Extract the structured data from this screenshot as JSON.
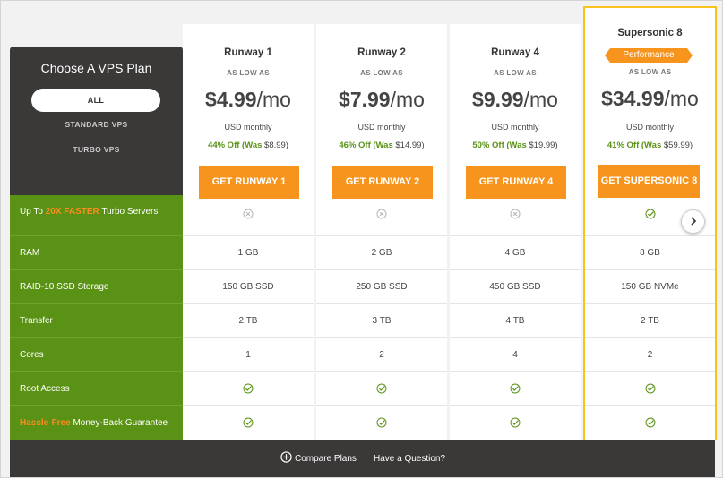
{
  "sidebar": {
    "title": "Choose A VPS Plan",
    "filters": [
      "ALL",
      "STANDARD VPS",
      "TURBO VPS"
    ],
    "features": [
      {
        "pre": "Up To ",
        "hl": "20X FASTER",
        "post": " Turbo Servers"
      },
      {
        "pre": "RAM",
        "hl": "",
        "post": ""
      },
      {
        "pre": "RAID-10 SSD Storage",
        "hl": "",
        "post": ""
      },
      {
        "pre": "Transfer",
        "hl": "",
        "post": ""
      },
      {
        "pre": "Cores",
        "hl": "",
        "post": ""
      },
      {
        "pre": "Root Access",
        "hl": "",
        "post": ""
      },
      {
        "pre": "",
        "hl": "Hassle-Free",
        "post": " Money-Back Guarantee"
      }
    ]
  },
  "plans": [
    {
      "name": "Runway 1",
      "badge": "",
      "low": "AS LOW AS",
      "price": "$4.99",
      "period": "/mo",
      "usd": "USD monthly",
      "off": "44% Off (Was",
      "was": " $8.99)",
      "cta": "GET RUNWAY 1",
      "turbo": "x",
      "ram": "1 GB",
      "storage": "150 GB SSD",
      "transfer": "2 TB",
      "cores": "1",
      "root": "check",
      "guarantee": "check"
    },
    {
      "name": "Runway 2",
      "badge": "",
      "low": "AS LOW AS",
      "price": "$7.99",
      "period": "/mo",
      "usd": "USD monthly",
      "off": "46% Off (Was",
      "was": " $14.99)",
      "cta": "GET RUNWAY 2",
      "turbo": "x",
      "ram": "2 GB",
      "storage": "250 GB SSD",
      "transfer": "3 TB",
      "cores": "2",
      "root": "check",
      "guarantee": "check"
    },
    {
      "name": "Runway 4",
      "badge": "",
      "low": "AS LOW AS",
      "price": "$9.99",
      "period": "/mo",
      "usd": "USD monthly",
      "off": "50% Off (Was",
      "was": " $19.99)",
      "cta": "GET RUNWAY 4",
      "turbo": "x",
      "ram": "4 GB",
      "storage": "450 GB SSD",
      "transfer": "4 TB",
      "cores": "4",
      "root": "check",
      "guarantee": "check"
    },
    {
      "name": "Supersonic 8",
      "badge": "Performance",
      "low": "AS LOW AS",
      "price": "$34.99",
      "period": "/mo",
      "usd": "USD monthly",
      "off": "41% Off (Was",
      "was": " $59.99)",
      "cta": "GET SUPERSONIC 8",
      "turbo": "check",
      "ram": "8 GB",
      "storage": "150 GB NVMe",
      "transfer": "2 TB",
      "cores": "2",
      "root": "check",
      "guarantee": "check"
    }
  ],
  "footer": {
    "compare": "Compare Plans",
    "question": "Have a Question?"
  },
  "colors": {
    "accent": "#f7941d",
    "green": "#5a9216",
    "dark": "#3b3838",
    "featured_border": "#f9c21f"
  },
  "icons": {
    "next": "chevron-right-icon",
    "compare": "plus-circle-icon",
    "included": "check-circle-icon",
    "excluded": "x-circle-icon"
  }
}
